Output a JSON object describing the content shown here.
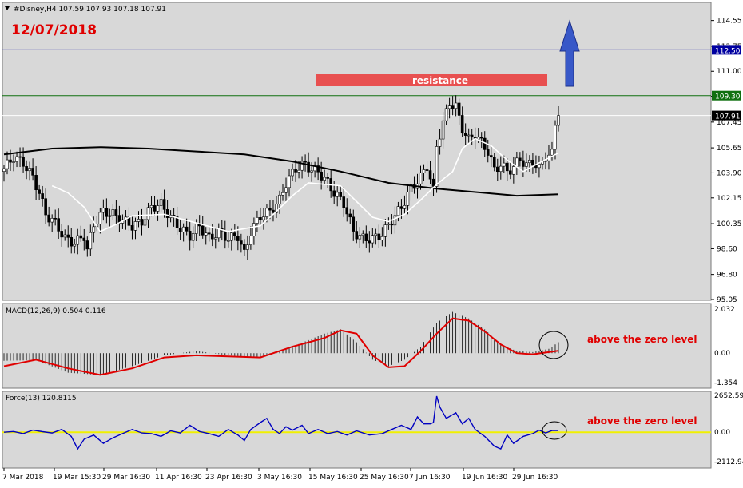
{
  "header": {
    "main_info": "#Disney,H4  107.59 107.93 107.18 107.91",
    "date_label": "12/07/2018",
    "macd_info": "MACD(12,26,9) 0.504 0.116",
    "force_info": "Force(13) 120.8115"
  },
  "annotations": {
    "resistance": "resistance",
    "macd_note": "above the zero level",
    "force_note": "above the zero level"
  },
  "colors": {
    "panel_bg": "#d8d8d8",
    "candle": "#000000",
    "slow_ma": "#000000",
    "fast_ma": "#ffffff",
    "resistance_box": "#e85050",
    "level_line": "#0000a0",
    "resistance_line": "#107010",
    "arrow": "#3858c8",
    "macd_signal": "#e00000",
    "force_line": "#0000c0",
    "zero_line": "#f0f000",
    "annotation_text": "#e00000"
  },
  "chart_data": [
    {
      "type": "candlestick",
      "panel": "price",
      "ylim": [
        95.05,
        115.2
      ],
      "y_ticks": [
        "114.55",
        "112.75",
        "111.00",
        "109.25",
        "107.45",
        "105.65",
        "103.90",
        "102.15",
        "100.35",
        "98.60",
        "96.80",
        "95.05"
      ],
      "levels": [
        {
          "label": "112.50",
          "value": 112.5
        },
        {
          "label": "109.30",
          "value": 109.3
        },
        {
          "label": "107.91",
          "value": 107.91
        }
      ],
      "resistance_zone": {
        "label": "resistance",
        "low": 109.3,
        "high": 110.7,
        "from": "15 May 16:30",
        "to": "3 Jul 00:30"
      },
      "x_tick_labels": [
        "7 Mar 2018",
        "19 Mar 15:30",
        "29 Mar 16:30",
        "11 Apr 16:30",
        "23 Apr 16:30",
        "3 May 16:30",
        "15 May 16:30",
        "25 May 16:30",
        "7 Jun 16:30",
        "19 Jun 16:30",
        "29 Jun 16:30"
      ],
      "close_path": [
        [
          0,
          104.2
        ],
        [
          3,
          105.0
        ],
        [
          6,
          104.6
        ],
        [
          9,
          103.6
        ],
        [
          11,
          102.5
        ],
        [
          13,
          101.0
        ],
        [
          16,
          100.4
        ],
        [
          19,
          99.3
        ],
        [
          22,
          99.0
        ],
        [
          25,
          99.5
        ],
        [
          26,
          98.5
        ],
        [
          28,
          100.3
        ],
        [
          31,
          101.2
        ],
        [
          34,
          101.0
        ],
        [
          37,
          100.6
        ],
        [
          40,
          100.2
        ],
        [
          43,
          100.5
        ],
        [
          46,
          101.5
        ],
        [
          49,
          101.7
        ],
        [
          52,
          100.8
        ],
        [
          55,
          100.0
        ],
        [
          58,
          99.5
        ],
        [
          61,
          100.2
        ],
        [
          64,
          99.3
        ],
        [
          67,
          99.8
        ],
        [
          70,
          99.3
        ],
        [
          73,
          99.5
        ],
        [
          75,
          98.2
        ],
        [
          77,
          99.8
        ],
        [
          80,
          100.9
        ],
        [
          83,
          101.2
        ],
        [
          86,
          102.0
        ],
        [
          88,
          103.2
        ],
        [
          91,
          104.2
        ],
        [
          94,
          104.5
        ],
        [
          96,
          104.1
        ],
        [
          98,
          104.0
        ],
        [
          101,
          103.2
        ],
        [
          103,
          102.5
        ],
        [
          106,
          101.8
        ],
        [
          109,
          99.8
        ],
        [
          112,
          99.3
        ],
        [
          115,
          99.3
        ],
        [
          118,
          99.6
        ],
        [
          121,
          100.6
        ],
        [
          124,
          101.5
        ],
        [
          127,
          102.8
        ],
        [
          130,
          103.6
        ],
        [
          132,
          104.4
        ],
        [
          134,
          102.6
        ],
        [
          135,
          105.8
        ],
        [
          137,
          107.4
        ],
        [
          139,
          108.8
        ],
        [
          141,
          108.5
        ],
        [
          143,
          107.0
        ],
        [
          145,
          106.2
        ],
        [
          147,
          106.6
        ],
        [
          149,
          106.0
        ],
        [
          151,
          105.4
        ],
        [
          153,
          104.1
        ],
        [
          155,
          104.5
        ],
        [
          157,
          104.0
        ],
        [
          159,
          104.3
        ],
        [
          161,
          104.9
        ],
        [
          163,
          104.4
        ],
        [
          165,
          104.7
        ],
        [
          167,
          104.2
        ],
        [
          169,
          105.1
        ],
        [
          171,
          105.2
        ],
        [
          172,
          107.3
        ],
        [
          173,
          107.91
        ]
      ],
      "slow_ma": [
        [
          0,
          105.2
        ],
        [
          15,
          105.6
        ],
        [
          30,
          105.7
        ],
        [
          45,
          105.6
        ],
        [
          60,
          105.4
        ],
        [
          75,
          105.2
        ],
        [
          90,
          104.7
        ],
        [
          105,
          104.0
        ],
        [
          120,
          103.2
        ],
        [
          135,
          102.8
        ],
        [
          150,
          102.5
        ],
        [
          160,
          102.3
        ],
        [
          173,
          102.4
        ]
      ],
      "fast_ma": [
        [
          15,
          103.0
        ],
        [
          20,
          102.5
        ],
        [
          25,
          101.5
        ],
        [
          30,
          99.8
        ],
        [
          35,
          100.3
        ],
        [
          40,
          100.9
        ],
        [
          50,
          101.0
        ],
        [
          60,
          100.4
        ],
        [
          70,
          99.8
        ],
        [
          80,
          100.2
        ],
        [
          85,
          101.2
        ],
        [
          90,
          102.3
        ],
        [
          95,
          103.2
        ],
        [
          105,
          103.0
        ],
        [
          115,
          100.8
        ],
        [
          120,
          100.5
        ],
        [
          125,
          101.0
        ],
        [
          130,
          102.0
        ],
        [
          135,
          103.1
        ],
        [
          140,
          104.0
        ],
        [
          143,
          105.6
        ],
        [
          147,
          106.3
        ],
        [
          152,
          105.8
        ],
        [
          157,
          104.8
        ],
        [
          162,
          104.0
        ],
        [
          167,
          104.6
        ],
        [
          173,
          105.3
        ]
      ]
    },
    {
      "type": "bar",
      "panel": "macd",
      "name": "MACD(12,26,9)",
      "ylim": [
        -1.354,
        2.032
      ],
      "y_ticks": [
        "2.032",
        "0.00",
        "-1.354"
      ],
      "histogram_path": [
        [
          0,
          -0.35
        ],
        [
          10,
          -0.32
        ],
        [
          20,
          -0.9
        ],
        [
          30,
          -1.0
        ],
        [
          40,
          -0.6
        ],
        [
          50,
          -0.1
        ],
        [
          60,
          0.1
        ],
        [
          70,
          -0.1
        ],
        [
          80,
          -0.2
        ],
        [
          90,
          0.3
        ],
        [
          100,
          0.9
        ],
        [
          105,
          1.1
        ],
        [
          110,
          0.5
        ],
        [
          115,
          -0.3
        ],
        [
          120,
          -0.6
        ],
        [
          125,
          -0.3
        ],
        [
          130,
          0.3
        ],
        [
          135,
          1.4
        ],
        [
          140,
          1.9
        ],
        [
          145,
          1.6
        ],
        [
          150,
          1.1
        ],
        [
          155,
          0.4
        ],
        [
          160,
          0.1
        ],
        [
          165,
          0.05
        ],
        [
          170,
          0.2
        ],
        [
          173,
          0.504
        ]
      ],
      "signal_path": [
        [
          0,
          -0.6
        ],
        [
          10,
          -0.3
        ],
        [
          20,
          -0.7
        ],
        [
          30,
          -1.0
        ],
        [
          40,
          -0.7
        ],
        [
          50,
          -0.2
        ],
        [
          60,
          -0.1
        ],
        [
          70,
          -0.15
        ],
        [
          80,
          -0.2
        ],
        [
          90,
          0.3
        ],
        [
          100,
          0.7
        ],
        [
          105,
          1.05
        ],
        [
          110,
          0.9
        ],
        [
          115,
          -0.1
        ],
        [
          120,
          -0.65
        ],
        [
          125,
          -0.6
        ],
        [
          130,
          0.1
        ],
        [
          135,
          0.9
        ],
        [
          140,
          1.6
        ],
        [
          145,
          1.5
        ],
        [
          150,
          1.0
        ],
        [
          155,
          0.4
        ],
        [
          160,
          0.0
        ],
        [
          165,
          -0.05
        ],
        [
          170,
          0.05
        ],
        [
          173,
          0.116
        ]
      ]
    },
    {
      "type": "line",
      "panel": "force",
      "name": "Force(13)",
      "ylim": [
        -2112.94,
        2652.592
      ],
      "y_ticks": [
        "2652.592",
        "0.00",
        "-2112.94"
      ],
      "values": [
        [
          0,
          0
        ],
        [
          3,
          50
        ],
        [
          6,
          -100
        ],
        [
          9,
          150
        ],
        [
          12,
          40
        ],
        [
          15,
          -50
        ],
        [
          18,
          200
        ],
        [
          21,
          -300
        ],
        [
          23,
          -1200
        ],
        [
          25,
          -500
        ],
        [
          28,
          -200
        ],
        [
          31,
          -800
        ],
        [
          34,
          -400
        ],
        [
          37,
          -100
        ],
        [
          40,
          200
        ],
        [
          43,
          -50
        ],
        [
          46,
          -100
        ],
        [
          49,
          -300
        ],
        [
          52,
          100
        ],
        [
          55,
          -50
        ],
        [
          58,
          500
        ],
        [
          61,
          50
        ],
        [
          64,
          -100
        ],
        [
          67,
          -300
        ],
        [
          70,
          200
        ],
        [
          73,
          -200
        ],
        [
          75,
          -600
        ],
        [
          77,
          200
        ],
        [
          80,
          700
        ],
        [
          82,
          1000
        ],
        [
          84,
          200
        ],
        [
          86,
          -100
        ],
        [
          88,
          400
        ],
        [
          90,
          150
        ],
        [
          93,
          500
        ],
        [
          95,
          -100
        ],
        [
          98,
          200
        ],
        [
          101,
          -100
        ],
        [
          104,
          50
        ],
        [
          107,
          -200
        ],
        [
          110,
          100
        ],
        [
          114,
          -200
        ],
        [
          118,
          -100
        ],
        [
          121,
          200
        ],
        [
          124,
          500
        ],
        [
          127,
          200
        ],
        [
          129,
          1100
        ],
        [
          131,
          600
        ],
        [
          133,
          600
        ],
        [
          134,
          700
        ],
        [
          135,
          2600
        ],
        [
          136,
          1800
        ],
        [
          138,
          1000
        ],
        [
          141,
          1400
        ],
        [
          143,
          600
        ],
        [
          145,
          1000
        ],
        [
          147,
          200
        ],
        [
          150,
          -300
        ],
        [
          153,
          -1000
        ],
        [
          155,
          -1200
        ],
        [
          157,
          -200
        ],
        [
          159,
          -800
        ],
        [
          162,
          -300
        ],
        [
          165,
          -100
        ],
        [
          167,
          150
        ],
        [
          169,
          -50
        ],
        [
          171,
          120
        ],
        [
          173,
          121
        ]
      ]
    }
  ]
}
